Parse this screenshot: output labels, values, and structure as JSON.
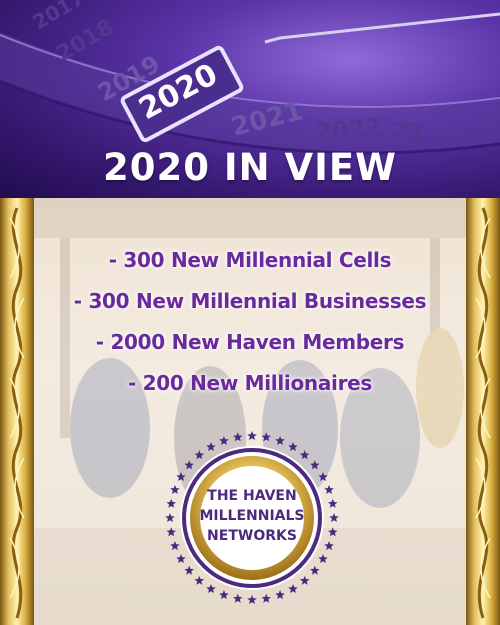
{
  "banner": {
    "title": "2020 IN VIEW",
    "dial_years": [
      "2017",
      "2018",
      "2019",
      "2020",
      "2021",
      "2022",
      "23"
    ],
    "highlight_year": "2020"
  },
  "goals": [
    "- 300 New Millennial Cells",
    "- 300 New Millennial Businesses",
    "- 2000 New Haven Members",
    "- 200 New Millionaires"
  ],
  "seal": {
    "line1": "THE HAVEN",
    "line2": "MILLENNIALS",
    "line3": "NETWORKS"
  },
  "colors": {
    "banner_purple": "#3b1c7a",
    "goal_text": "#6a2a9e",
    "frame_gold": "#e4c060",
    "seal_purple": "#4c2b7e"
  }
}
